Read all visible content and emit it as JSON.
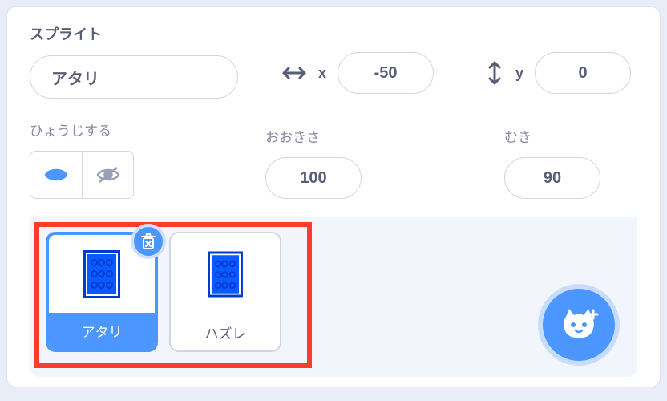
{
  "sprite": {
    "section_label": "スプライト",
    "name": "アタリ",
    "x_label": "x",
    "x_value": "-50",
    "y_label": "y",
    "y_value": "0"
  },
  "visibility": {
    "label": "ひょうじする",
    "shown": true
  },
  "size": {
    "label": "おおきさ",
    "value": "100"
  },
  "direction": {
    "label": "むき",
    "value": "90"
  },
  "sprite_list": {
    "items": [
      {
        "name": "アタリ",
        "selected": true
      },
      {
        "name": "ハズレ",
        "selected": false
      }
    ]
  },
  "icons": {
    "arrows_h": "↔",
    "arrows_v": "↕",
    "trash": "🗑",
    "cat_plus": "🐱+"
  },
  "colors": {
    "accent": "#4c97ff",
    "highlight": "#ff3b30"
  }
}
